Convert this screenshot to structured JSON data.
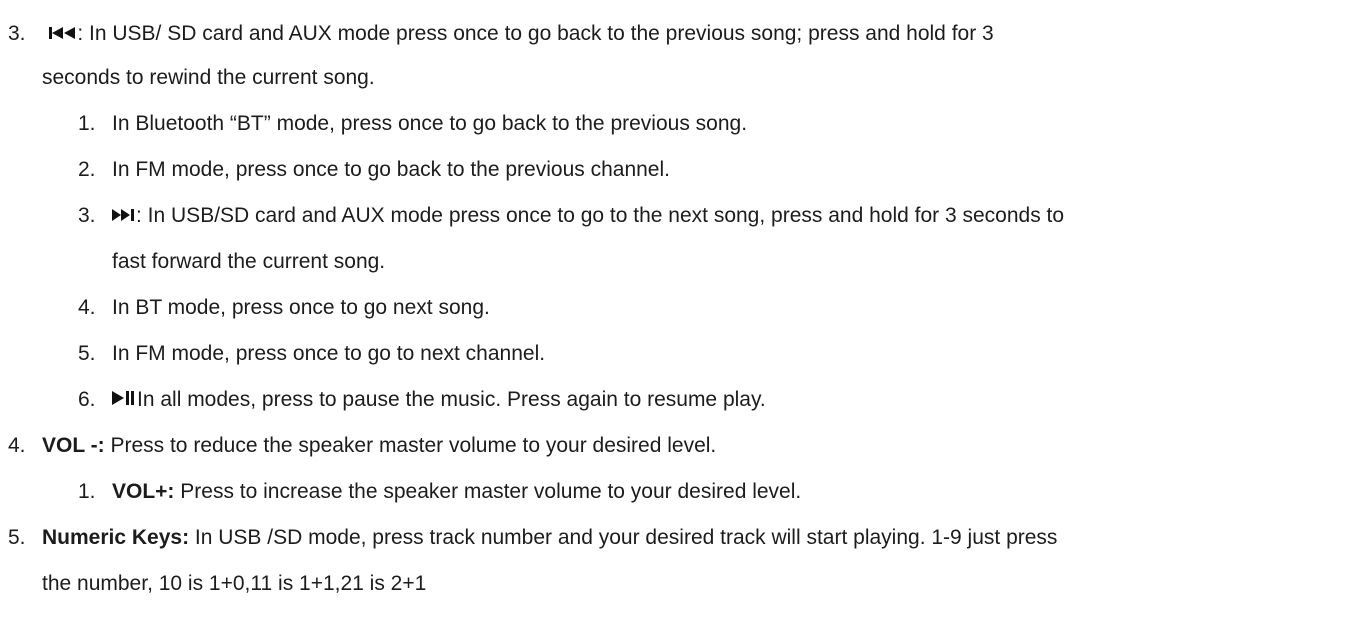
{
  "items": [
    {
      "number": "3.",
      "icon": "skip-back-icon",
      "text_line1": ": In USB/ SD card and AUX mode press once to go back to the previous song; press and hold for 3",
      "text_line2": "seconds to rewind the current song."
    },
    {
      "number": "1.",
      "text": "In Bluetooth “BT” mode, press once to go back to the previous song."
    },
    {
      "number": "2.",
      "text": "In FM mode, press once to go back to the previous channel."
    },
    {
      "number": "3.",
      "icon": "skip-forward-icon",
      "text_line1": ": In USB/SD card and AUX mode press once to go to the next song, press and hold for 3 seconds to",
      "text_line2": "fast forward the current song."
    },
    {
      "number": "4.",
      "text": "In BT mode, press once to go next song."
    },
    {
      "number": "5.",
      "text": "In FM mode, press once to go to next channel."
    },
    {
      "number": "6.",
      "icon": "play-pause-icon",
      "text": "In all modes, press to pause the music. Press again to resume play."
    },
    {
      "number": "4.",
      "bold": "VOL -:",
      "text": " Press to reduce the speaker master volume to your desired level."
    },
    {
      "number": "1.",
      "bold": "VOL+:",
      "text": " Press to increase the speaker master volume to your desired level."
    },
    {
      "number": "5.",
      "bold": "Numeric Keys:",
      "text_line1": " In USB /SD mode, press track number and your desired track will start playing. 1-9 just press",
      "text_line2": "the number, 10 is 1+0,11 is 1+1,21 is 2+1"
    }
  ]
}
